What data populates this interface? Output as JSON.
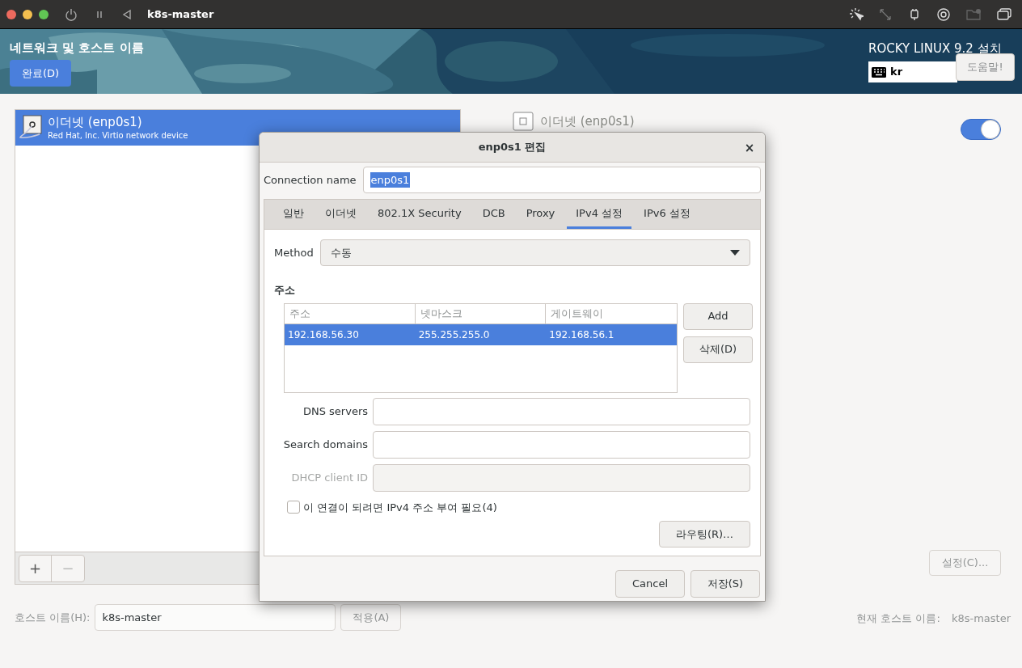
{
  "vm_bar": {
    "title": "k8s-master"
  },
  "header": {
    "title": "네트워크 및 호스트 이름",
    "done_button": "완료(D)",
    "product": "ROCKY LINUX 9.2 설치",
    "keyboard_layout": "kr",
    "help_button": "도움말!"
  },
  "devices": [
    {
      "name": "이더넷 (enp0s1)",
      "description": "Red Hat, Inc. Virtio network device",
      "selected": true
    }
  ],
  "device_detail": {
    "name": "이더넷 (enp0s1)",
    "on": true,
    "configure_button": "설정(C)..."
  },
  "list_toolbar": {
    "add": "+",
    "remove": "−"
  },
  "hostname": {
    "label": "호스트 이름(H):",
    "value": "k8s-master",
    "apply_button": "적용(A)",
    "current_label": "현재 호스트 이름:",
    "current_value": "k8s-master"
  },
  "dialog": {
    "title": "enp0s1 편집",
    "close": "×",
    "connection_name_label": "Connection name",
    "connection_name": "enp0s1",
    "tabs": [
      {
        "label": "일반",
        "selected": false
      },
      {
        "label": "이더넷",
        "selected": false
      },
      {
        "label": "802.1X Security",
        "selected": false
      },
      {
        "label": "DCB",
        "selected": false
      },
      {
        "label": "Proxy",
        "selected": false
      },
      {
        "label": "IPv4 설정",
        "selected": true
      },
      {
        "label": "IPv6 설정",
        "selected": false
      }
    ],
    "method_label": "Method",
    "method": "수동",
    "addresses_heading": "주소",
    "address_table": {
      "columns": [
        "주소",
        "넷마스크",
        "게이트웨이"
      ],
      "rows": [
        {
          "cells": [
            "192.168.56.30",
            "255.255.255.0",
            "192.168.56.1"
          ],
          "selected": true
        }
      ]
    },
    "add_button": "Add",
    "delete_button": "삭제(D)",
    "fields": [
      {
        "label": "DNS servers",
        "disabled": false
      },
      {
        "label": "Search domains",
        "disabled": false
      },
      {
        "label": "DHCP client ID",
        "disabled": true
      }
    ],
    "require_ipv4": {
      "label": "이 연결이 되려면 IPv4 주소 부여 필요(4)",
      "checked": false
    },
    "routes_button": "라우팅(R)…",
    "cancel_button": "Cancel",
    "save_button": "저장(S)"
  }
}
